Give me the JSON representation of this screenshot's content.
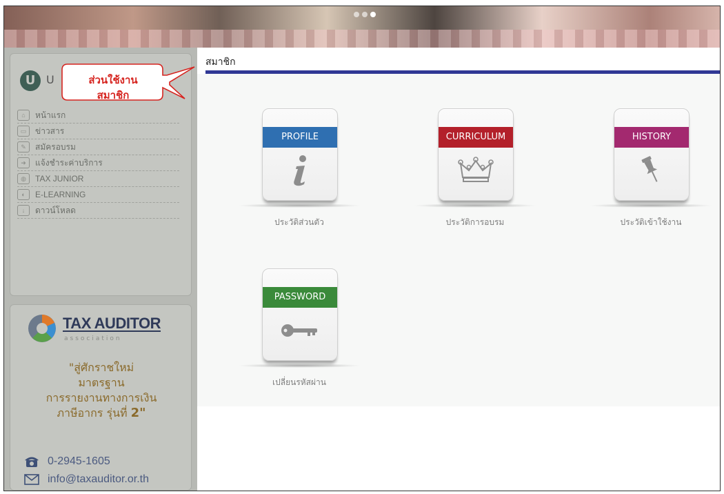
{
  "sidebar": {
    "menu_header_initial": "U",
    "menu_items": [
      {
        "label": "หน้าแรก",
        "icon": "home-icon"
      },
      {
        "label": "ข่าวสาร",
        "icon": "news-icon"
      },
      {
        "label": "สมัครอบรม",
        "icon": "register-icon"
      },
      {
        "label": "แจ้งชำระค่าบริการ",
        "icon": "payment-icon"
      },
      {
        "label": "TAX JUNIOR",
        "icon": "group-icon"
      },
      {
        "label": "E-LEARNING",
        "icon": "elearning-icon"
      },
      {
        "label": "ดาวน์โหลด",
        "icon": "download-icon"
      }
    ],
    "promo": {
      "logo_title": "TAX AUDITOR",
      "logo_sub": "association",
      "line1": "\"สู่ศักราชใหม่",
      "line2": "มาตรฐาน",
      "line3": "การรายงานทางการเงิน",
      "line4_prefix": "ภาษีอากร รุ่นที่ ",
      "line4_number": "2\"",
      "phone": "0-2945-1605",
      "email": "info@taxauditor.or.th"
    }
  },
  "callout": {
    "line1": "ส่วนใช้งาน",
    "line2": "สมาชิก",
    "color": "#d6241f"
  },
  "main": {
    "title": "สมาชิก",
    "tiles": [
      {
        "band": "PROFILE",
        "caption": "ประวัติส่วนตัว",
        "band_color": "#2f6fb1",
        "icon": "info-icon"
      },
      {
        "band": "CURRICULUM",
        "caption": "ประวัติการอบรม",
        "band_color": "#b3202a",
        "icon": "crown-icon"
      },
      {
        "band": "HISTORY",
        "caption": "ประวัติเข้าใช้งาน",
        "band_color": "#a3296f",
        "icon": "pushpin-icon"
      },
      {
        "band": "PASSWORD",
        "caption": "เปลี่ยนรหัสผ่าน",
        "band_color": "#3a8a3a",
        "icon": "key-icon"
      }
    ]
  }
}
